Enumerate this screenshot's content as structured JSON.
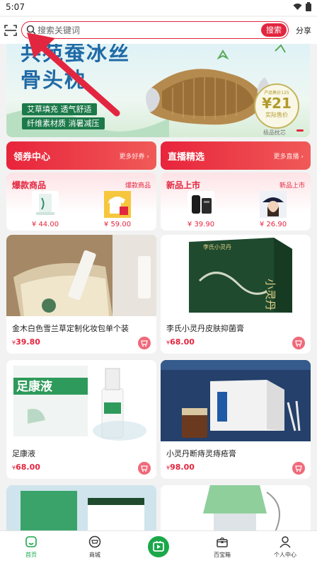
{
  "status_bar": {
    "time": "5:07"
  },
  "search": {
    "placeholder": "搜索关键词",
    "button": "搜索",
    "share": "分享"
  },
  "banner": {
    "title_line1": "共苑蚕冰丝",
    "title_line2": "骨头枕",
    "tag1": "艾草填充 透气舒适",
    "tag2": "纤维素材质 消暑减压",
    "price_pre": "产品售价125",
    "price": "¥21",
    "price_post": "实际售价",
    "caption": "极品枕芯"
  },
  "promos": [
    {
      "title": "领券中心",
      "more": "更多好券 ›"
    },
    {
      "title": "直播精选",
      "more": "更多直播 ›"
    }
  ],
  "categories": [
    {
      "title": "爆款商品",
      "more": "爆款商品",
      "items": [
        {
          "price": "¥ 44.00"
        },
        {
          "price": "¥ 59.00"
        }
      ]
    },
    {
      "title": "新品上市",
      "more": "新品上市",
      "items": [
        {
          "price": "¥ 39.90"
        },
        {
          "price": "¥ 26.90"
        }
      ]
    }
  ],
  "products": [
    {
      "name": "金木白色雪兰草定制化妆包单个装",
      "yen": "¥",
      "price": "39.80"
    },
    {
      "name": "李氏小灵丹皮肤抑菌膏",
      "yen": "¥",
      "price": "68.00"
    },
    {
      "name": "足康液",
      "yen": "¥",
      "price": "68.00"
    },
    {
      "name": "小灵丹断痔灵痔疮膏",
      "yen": "¥",
      "price": "98.00"
    }
  ],
  "product_image_text": {
    "xiaolingdan": "小灵丹",
    "brand": "李氏小灵丹",
    "zukangye": "足康液"
  },
  "tabbar": [
    {
      "label": "首页"
    },
    {
      "label": "商城"
    },
    {
      "label": ""
    },
    {
      "label": "百宝箱"
    },
    {
      "label": "个人中心"
    }
  ],
  "colors": {
    "accent": "#e3263f",
    "green": "#1aa84a",
    "banner_blue": "#1f6aa6"
  }
}
